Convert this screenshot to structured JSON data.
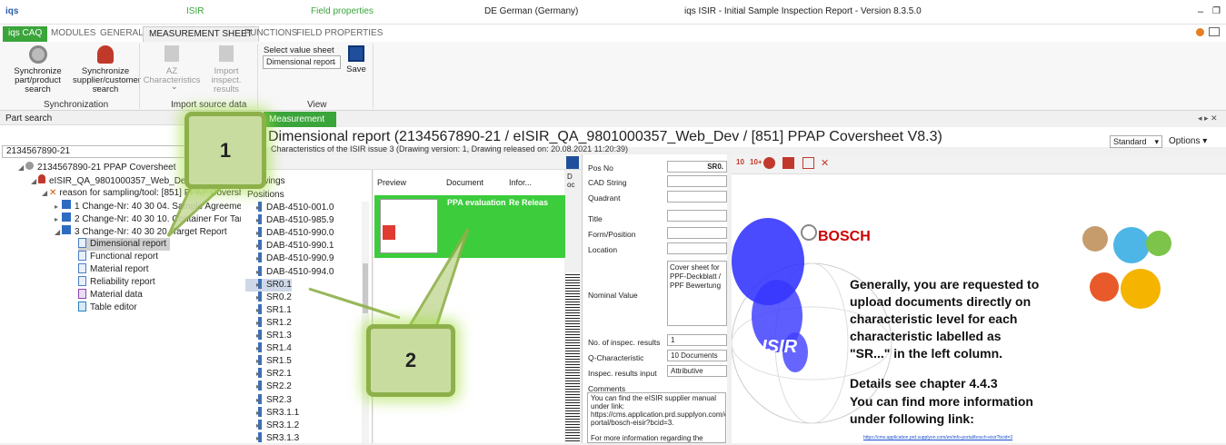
{
  "titlebar": {
    "app_short": "iqs",
    "isir": "ISIR",
    "field_props": "Field properties",
    "language": "DE German (Germany)",
    "window_title": "iqs ISIR - Initial Sample Inspection Report - Version 8.3.5.0"
  },
  "tabs": [
    "iqs CAQ",
    "MODULES",
    "GENERAL",
    "MEASUREMENT SHEET",
    "FUNCTIONS",
    "FIELD PROPERTIES"
  ],
  "ribbon": {
    "sync_part": "Synchronize part/product search",
    "sync_supplier": "Synchronize supplier/customer search",
    "az_char": "AZ Characteristics",
    "import_results": "Import inspect. results",
    "select_value_sheet": "Select value sheet",
    "value_sheet_selected": "Dimensional report",
    "save": "Save",
    "group_sync": "Synchronization",
    "group_import": "Import source data",
    "group_view": "View"
  },
  "left": {
    "header": "Part search",
    "search_value": "2134567890-21",
    "tree": [
      "2134567890-21 PPAP Coversheet",
      "eISIR_QA_9801000357_Web_Dev (980100035",
      "reason for sampling/tool: [851] PPAP Coversheet V",
      "1  Change-Nr: 40 30 04. Sample Agreement",
      "2  Change-Nr: 40 30 10. Container For Target F",
      "3  Change-Nr: 40 30 20. Target Report",
      "Dimensional report",
      "Functional report",
      "Material report",
      "Reliability report",
      "Material data",
      "Table editor"
    ]
  },
  "main": {
    "doc_tab": "Measurement she...",
    "title": "Dimensional report (2134567890-21 / eISIR_QA_9801000357_Web_Dev / [851] PPAP Coversheet V8.3)",
    "subtitle": "Characteristics of the ISIR issue 3 (Drawing version: 1, Drawing released on: 20.08.2021 11:20:39)",
    "standard": "Standard",
    "options": "Options"
  },
  "drawings": {
    "drawings_label": "Drawings",
    "positions_label": "Positions",
    "items": [
      "DAB-4510-001.0",
      "DAB-4510-985.9",
      "DAB-4510-990.0",
      "DAB-4510-990.1",
      "DAB-4510-990.9",
      "DAB-4510-994.0",
      "SR0.1",
      "SR0.2",
      "SR1.1",
      "SR1.2",
      "SR1.3",
      "SR1.4",
      "SR1.5",
      "SR2.1",
      "SR2.2",
      "SR2.3",
      "SR3.1.1",
      "SR3.1.2",
      "SR3.1.3"
    ]
  },
  "docs": {
    "col_preview": "Preview",
    "col_document": "Document",
    "col_info": "Infor...",
    "col_d": "D oc",
    "row_doc": "PPA evaluation",
    "row_info": "Re Releas"
  },
  "form": {
    "pos_no_label": "Pos No",
    "pos_no": "SR0.",
    "cad": "CAD String",
    "quadrant": "Quadrant",
    "title": "Title",
    "form_pos": "Form/Position",
    "location": "Location",
    "nominal": "Nominal Value",
    "nominal_val": "Cover sheet for PPF-Deckblatt / PPF Bewertung",
    "num_results": "No. of inspec. results",
    "num_results_val": "1",
    "qchar": "Q-Characteristic",
    "qchar_val": "10 Documents",
    "input": "Inspec. results input",
    "input_val": "Attributive",
    "comments": "Comments",
    "comments_val": "You can find the eISIR supplier manual under link: https://cms.application.prd.supplyon.com/en/info-portal/bosch-eisir?bcid=3.",
    "comments_more": "For more information regarding the requeste"
  },
  "preview": {
    "brand": "BOSCH",
    "eisir": "eISIR",
    "p1": "Generally, you are requested to",
    "p2": "upload documents directly on",
    "p3": "characteristic level for each",
    "p4": "characteristic labelled as",
    "p5": "\"SR...\" in the left column.",
    "p6": "Details see chapter 4.4.3",
    "p7": "You can find more information",
    "p8": "under following link:",
    "link": "https://cms.application.prd.supplyon.com/en/info-portal/bosch-eisir?bcid=3"
  },
  "callouts": [
    "1",
    "2"
  ]
}
